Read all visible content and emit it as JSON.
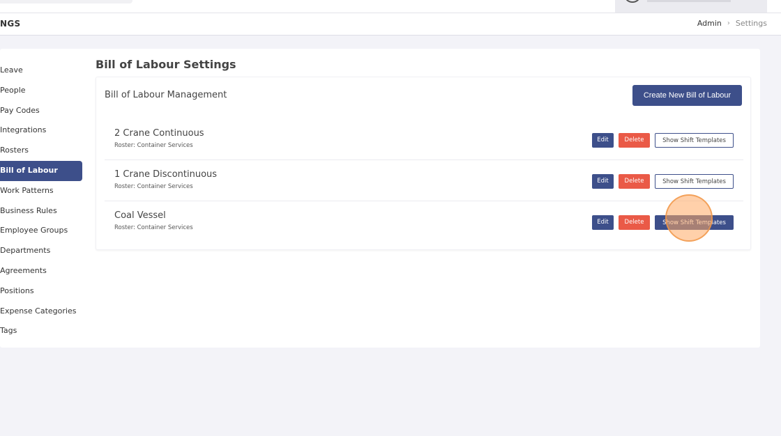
{
  "header": {
    "page_title": "NGS",
    "breadcrumb": {
      "admin": "Admin",
      "separator": "›",
      "current": "Settings"
    }
  },
  "sidebar": {
    "items": [
      {
        "label": "Leave",
        "active": false
      },
      {
        "label": "People",
        "active": false
      },
      {
        "label": "Pay Codes",
        "active": false
      },
      {
        "label": "Integrations",
        "active": false
      },
      {
        "label": "Rosters",
        "active": false
      },
      {
        "label": "Bill of Labour",
        "active": true
      },
      {
        "label": "Work Patterns",
        "active": false
      },
      {
        "label": "Business Rules",
        "active": false
      },
      {
        "label": "Employee Groups",
        "active": false
      },
      {
        "label": "Departments",
        "active": false
      },
      {
        "label": "Agreements",
        "active": false
      },
      {
        "label": "Positions",
        "active": false
      },
      {
        "label": "Expense Categories",
        "active": false
      },
      {
        "label": "Tags",
        "active": false
      }
    ]
  },
  "main": {
    "title": "Bill of Labour Settings",
    "panel_title": "Bill of Labour Management",
    "create_label": "Create New Bill of Labour",
    "rows": [
      {
        "name": "2 Crane Continuous",
        "subtitle": "Roster: Container Services",
        "edit": "Edit",
        "delete": "Delete",
        "templates": "Show Shift Templates"
      },
      {
        "name": "1 Crane Discontinuous",
        "subtitle": "Roster: Container Services",
        "edit": "Edit",
        "delete": "Delete",
        "templates": "Show Shift Templates"
      },
      {
        "name": "Coal Vessel",
        "subtitle": "Roster: Container Services",
        "edit": "Edit",
        "delete": "Delete",
        "templates": "Show Shift Templates"
      }
    ]
  },
  "colors": {
    "primary": "#3d4f8a",
    "danger": "#ea5a47",
    "background": "#f3f3f8"
  }
}
